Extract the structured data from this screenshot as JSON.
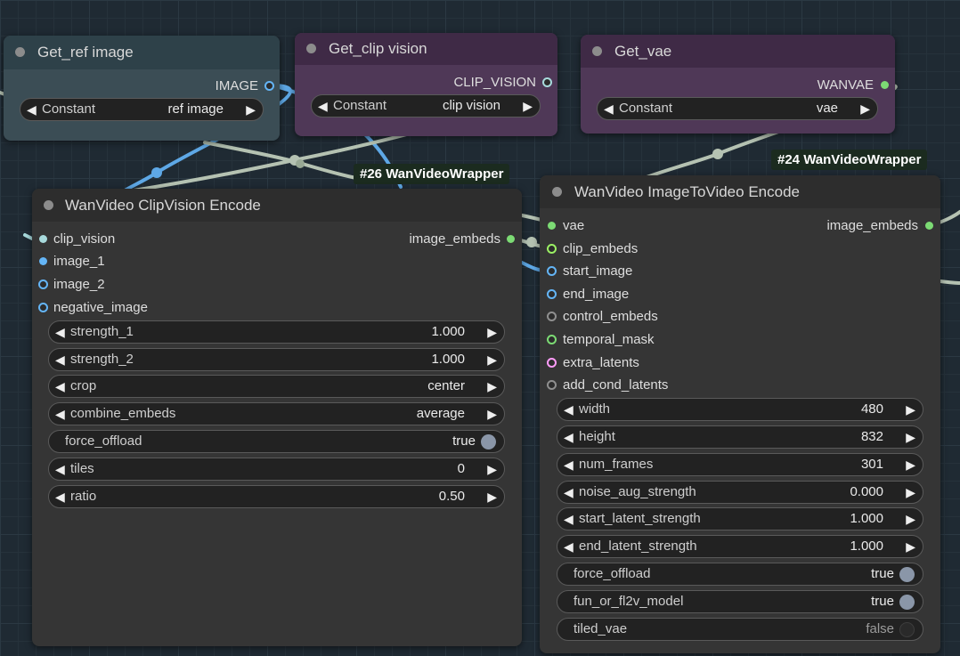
{
  "colors": {
    "image": "#64b5f6",
    "clip_vision": "#a8dadc",
    "wanvae": "#7cdb74",
    "clip_embeds": "#9bf064",
    "control": "#8f8f8f",
    "latent": "#ff9cf9",
    "link_gray": "#b5c2b2",
    "link_blue": "#5ea8e6"
  },
  "nodes": {
    "get_ref": {
      "title": "Get_ref image",
      "output": "IMAGE",
      "widget": {
        "name": "Constant",
        "value": "ref image"
      }
    },
    "get_clip": {
      "title": "Get_clip vision",
      "output": "CLIP_VISION",
      "widget": {
        "name": "Constant",
        "value": "clip vision"
      }
    },
    "get_vae": {
      "title": "Get_vae",
      "output": "WANVAE",
      "widget": {
        "name": "Constant",
        "value": "vae"
      }
    },
    "clipvision_encode": {
      "badge": "#26 WanVideoWrapper",
      "title": "WanVideo ClipVision Encode",
      "inputs": [
        "clip_vision",
        "image_1",
        "image_2",
        "negative_image"
      ],
      "output": "image_embeds",
      "widgets": [
        {
          "name": "strength_1",
          "value": "1.000"
        },
        {
          "name": "strength_2",
          "value": "1.000"
        },
        {
          "name": "crop",
          "value": "center"
        },
        {
          "name": "combine_embeds",
          "value": "average"
        },
        {
          "name": "force_offload",
          "value": "true"
        },
        {
          "name": "tiles",
          "value": "0"
        },
        {
          "name": "ratio",
          "value": "0.50"
        }
      ]
    },
    "imagetovideo_encode": {
      "badge": "#24 WanVideoWrapper",
      "title": "WanVideo ImageToVideo Encode",
      "inputs": [
        "vae",
        "clip_embeds",
        "start_image",
        "end_image",
        "control_embeds",
        "temporal_mask",
        "extra_latents",
        "add_cond_latents"
      ],
      "output": "image_embeds",
      "widgets": [
        {
          "name": "width",
          "value": "480"
        },
        {
          "name": "height",
          "value": "832"
        },
        {
          "name": "num_frames",
          "value": "301"
        },
        {
          "name": "noise_aug_strength",
          "value": "0.000"
        },
        {
          "name": "start_latent_strength",
          "value": "1.000"
        },
        {
          "name": "end_latent_strength",
          "value": "1.000"
        },
        {
          "name": "force_offload",
          "value": "true"
        },
        {
          "name": "fun_or_fl2v_model",
          "value": "true"
        },
        {
          "name": "tiled_vae",
          "value": "false"
        }
      ]
    }
  }
}
